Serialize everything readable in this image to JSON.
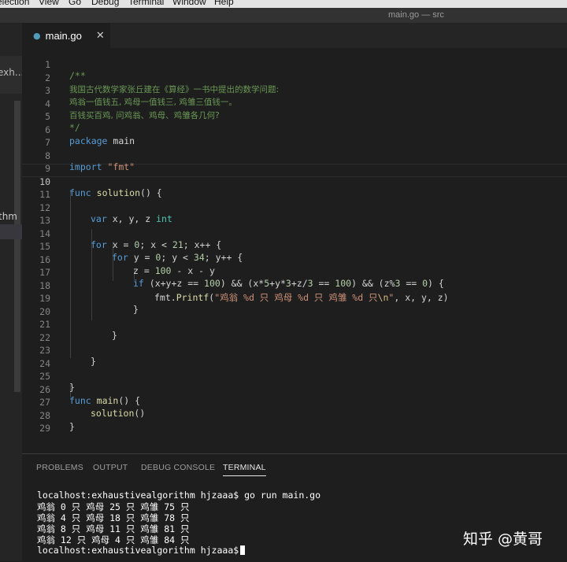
{
  "menubar": [
    "election",
    "View",
    "Go",
    "Debug",
    "Terminal",
    "Window",
    "Help"
  ],
  "window_title": "main.go — src",
  "sidebar": {
    "tab_label": "exh...",
    "item_label": "thm"
  },
  "tab": {
    "filename": "main.go",
    "close": "✕",
    "icon": "go-file-icon"
  },
  "editor": {
    "line_numbers": [
      "1",
      "2",
      "3",
      "4",
      "5",
      "6",
      "7",
      "8",
      "9",
      "10",
      "11",
      "12",
      "13",
      "14",
      "15",
      "16",
      "17",
      "18",
      "19",
      "20",
      "21",
      "22",
      "23",
      "24",
      "25",
      "26",
      "27",
      "28",
      "29"
    ],
    "current_line": "10",
    "tokens": {
      "l1": "/**",
      "l2": "我国古代数学家张丘建在《算经》一书中提出的数学问题:",
      "l3": "鸡翁一值钱五, 鸡母一值钱三, 鸡雏三值钱一。",
      "l4": "百钱买百鸡, 问鸡翁、鸡母、鸡雏各几何?",
      "l5": "*/",
      "l6_kw": "package",
      "l6_rest": " main",
      "l8_kw": "import",
      "l8_str": " \"fmt\"",
      "l10_kw": "func",
      "l10_fn": "solution",
      "l10_rest": "() {",
      "l12_kw": "var",
      "l12_mid": " x, y, z ",
      "l12_ty": "int",
      "l14_kw": "for",
      "l14_a": " x = ",
      "l14_n1": "0",
      "l14_b": "; x < ",
      "l14_n2": "21",
      "l14_c": "; x++ {",
      "l15_kw": "for",
      "l15_a": " y = ",
      "l15_n1": "0",
      "l15_b": "; y < ",
      "l15_n2": "34",
      "l15_c": "; y++ {",
      "l16_a": "z = ",
      "l16_n": "100",
      "l16_b": " - x - y",
      "l17_kw": "if",
      "l17_a": " (x+y+z == ",
      "l17_n1": "100",
      "l17_b": ") && (x*",
      "l17_n2": "5",
      "l17_c": "+y*",
      "l17_n3": "3",
      "l17_d": "+z/",
      "l17_n4": "3",
      "l17_e": " == ",
      "l17_n5": "100",
      "l17_f": ") && (z%",
      "l17_n6": "3",
      "l17_g": " == ",
      "l17_n7": "0",
      "l17_h": ") {",
      "l18_a": "fmt.",
      "l18_fn": "Printf",
      "l18_b": "(",
      "l18_str": "\"鸡翁 %d 只 鸡母 %d 只 鸡雏 %d 只",
      "l18_esc": "\\n",
      "l18_str2": "\"",
      "l18_c": ", x, y, z)",
      "l19": "}",
      "l21": "}",
      "l23": "}",
      "l25": "}",
      "l26_kw": "func",
      "l26_fn": "main",
      "l26_rest": "() {",
      "l27_fn": "solution",
      "l27_rest": "()",
      "l28": "}"
    }
  },
  "panel": {
    "tabs": [
      "PROBLEMS",
      "OUTPUT",
      "DEBUG CONSOLE",
      "TERMINAL"
    ],
    "active_tab": "TERMINAL",
    "terminal_lines": [
      "localhost:exhaustivealgorithm hjzaaa$ go run main.go",
      "鸡翁 0 只 鸡母 25 只 鸡雏 75 只",
      "鸡翁 4 只 鸡母 18 只 鸡雏 78 只",
      "鸡翁 8 只 鸡母 11 只 鸡雏 81 只",
      "鸡翁 12 只 鸡母 4 只 鸡雏 84 只",
      "localhost:exhaustivealgorithm hjzaaa$"
    ]
  },
  "watermark": "知乎 @黄哥"
}
